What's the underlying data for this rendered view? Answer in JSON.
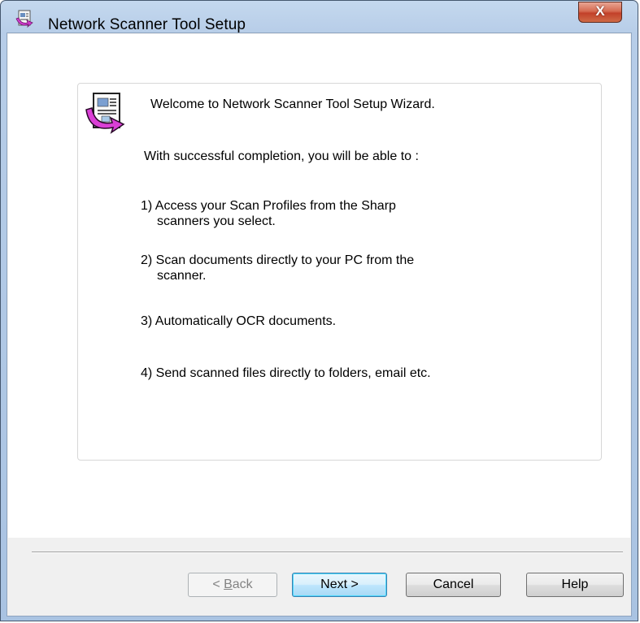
{
  "window": {
    "title": "Network Scanner Tool Setup",
    "close_symbol": "X"
  },
  "welcome": {
    "heading": "Welcome to Network Scanner Tool Setup Wizard.",
    "intro": "With successful completion, you will be able to :",
    "items": [
      {
        "lines": [
          "1)  Access your Scan Profiles from the Sharp",
          "scanners you select."
        ]
      },
      {
        "lines": [
          "2)  Scan documents directly to your PC from the",
          "scanner."
        ]
      },
      {
        "lines": [
          "3)  Automatically OCR documents."
        ]
      },
      {
        "lines": [
          "4)  Send scanned files directly to folders, email etc."
        ]
      }
    ]
  },
  "buttons": {
    "back_prefix": "< ",
    "back_mnemonic": "B",
    "back_rest": "ack",
    "next": "Next >",
    "cancel": "Cancel",
    "help": "Help"
  }
}
